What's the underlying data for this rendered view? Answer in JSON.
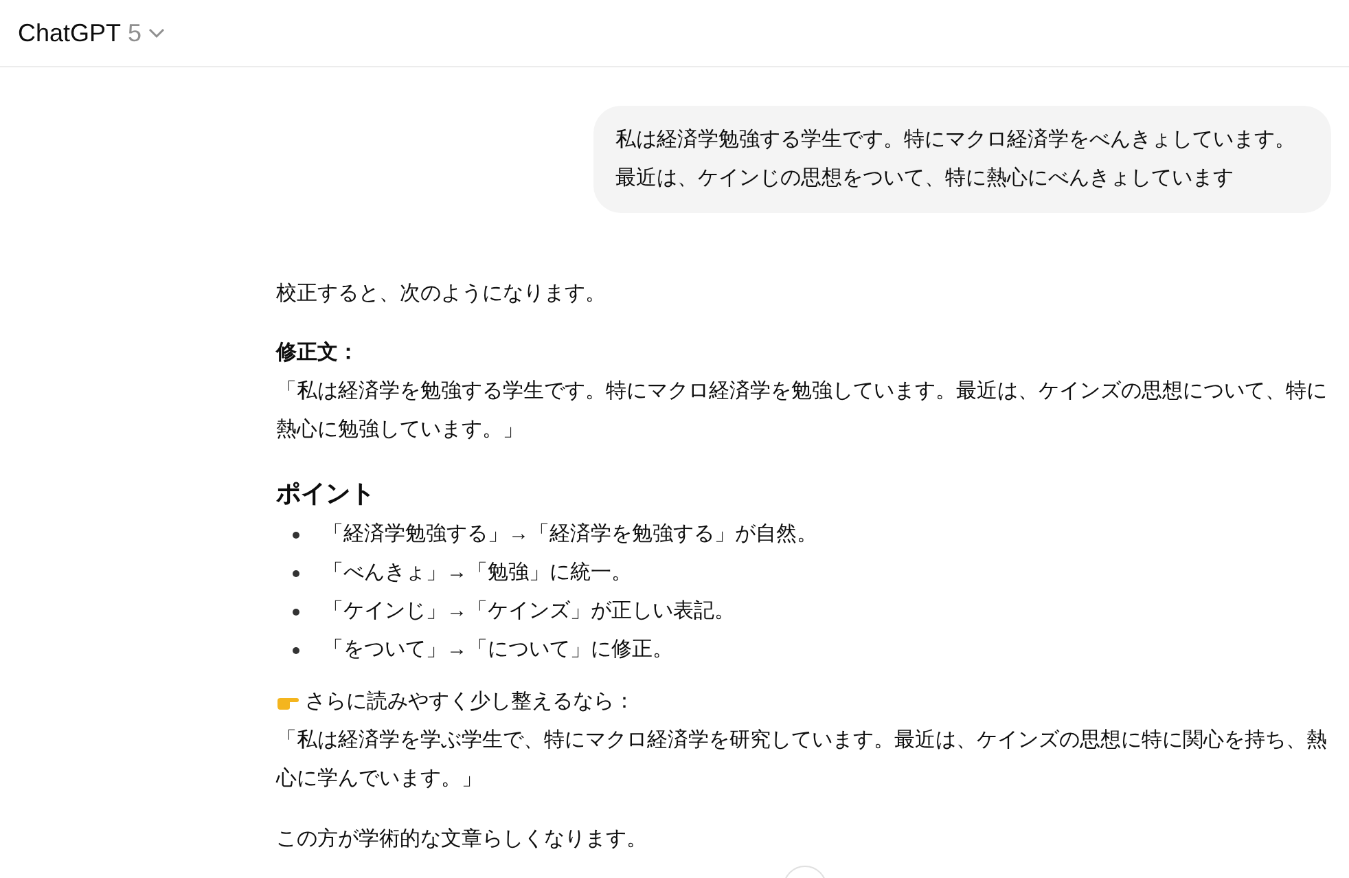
{
  "header": {
    "title": "ChatGPT",
    "version": "5"
  },
  "user_message": "私は経済学勉強する学生です。特にマクロ経済学をべんきょしています。最近は、ケインじの思想をついて、特に熱心にべんきょしています",
  "response": {
    "intro": "校正すると、次のようになります。",
    "corrected_label": "修正文：",
    "corrected_text": "「私は経済学を勉強する学生です。特にマクロ経済学を勉強しています。最近は、ケインズの思想について、特に熱心に勉強しています。」",
    "points_heading": "ポイント",
    "points": [
      "「経済学勉強する」→「経済学を勉強する」が自然。",
      "「べんきょ」→「勉強」に統一。",
      "「ケインじ」→「ケインズ」が正しい表記。",
      "「をついて」→「について」に修正。"
    ],
    "suggestion_label": "さらに読みやすく少し整えるなら：",
    "suggestion_text": "「私は経済学を学ぶ学生で、特にマクロ経済学を研究しています。最近は、ケインズの思想に特に関心を持ち、熱心に学んでいます。」",
    "closing": "この方が学術的な文章らしくなります。"
  }
}
